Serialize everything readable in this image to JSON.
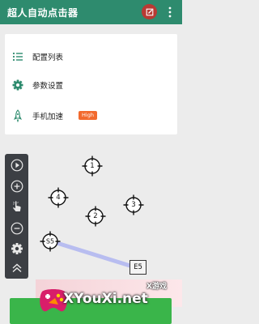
{
  "app": {
    "title": "超人自动点击器"
  },
  "header": {
    "edit_icon": "edit-icon",
    "more_icon": "more-vert-icon"
  },
  "menu": {
    "items": [
      {
        "label": "配置列表",
        "icon": "list-icon"
      },
      {
        "label": "参数设置",
        "icon": "gear-icon"
      },
      {
        "label": "手机加速",
        "icon": "rocket-icon",
        "badge": "High"
      }
    ]
  },
  "toolbar": {
    "tools": [
      "play-icon",
      "add-icon",
      "pointer-hand-icon",
      "remove-icon",
      "gear-icon",
      "collapse-up-icon"
    ]
  },
  "targets": {
    "t1": "1",
    "t2": "2",
    "t3": "3",
    "t4": "4",
    "s5": "S5",
    "e5": "E5"
  },
  "watermark": {
    "site": "XYouXi.net",
    "name": "X游戏"
  },
  "colors": {
    "appbar": "#2e8b6e",
    "edit_button": "#b83a33",
    "badge": "#f26a2e",
    "toolbar": "#3c3f44",
    "swipe_line": "#b8bdf0",
    "action_button": "#3ab54a"
  }
}
